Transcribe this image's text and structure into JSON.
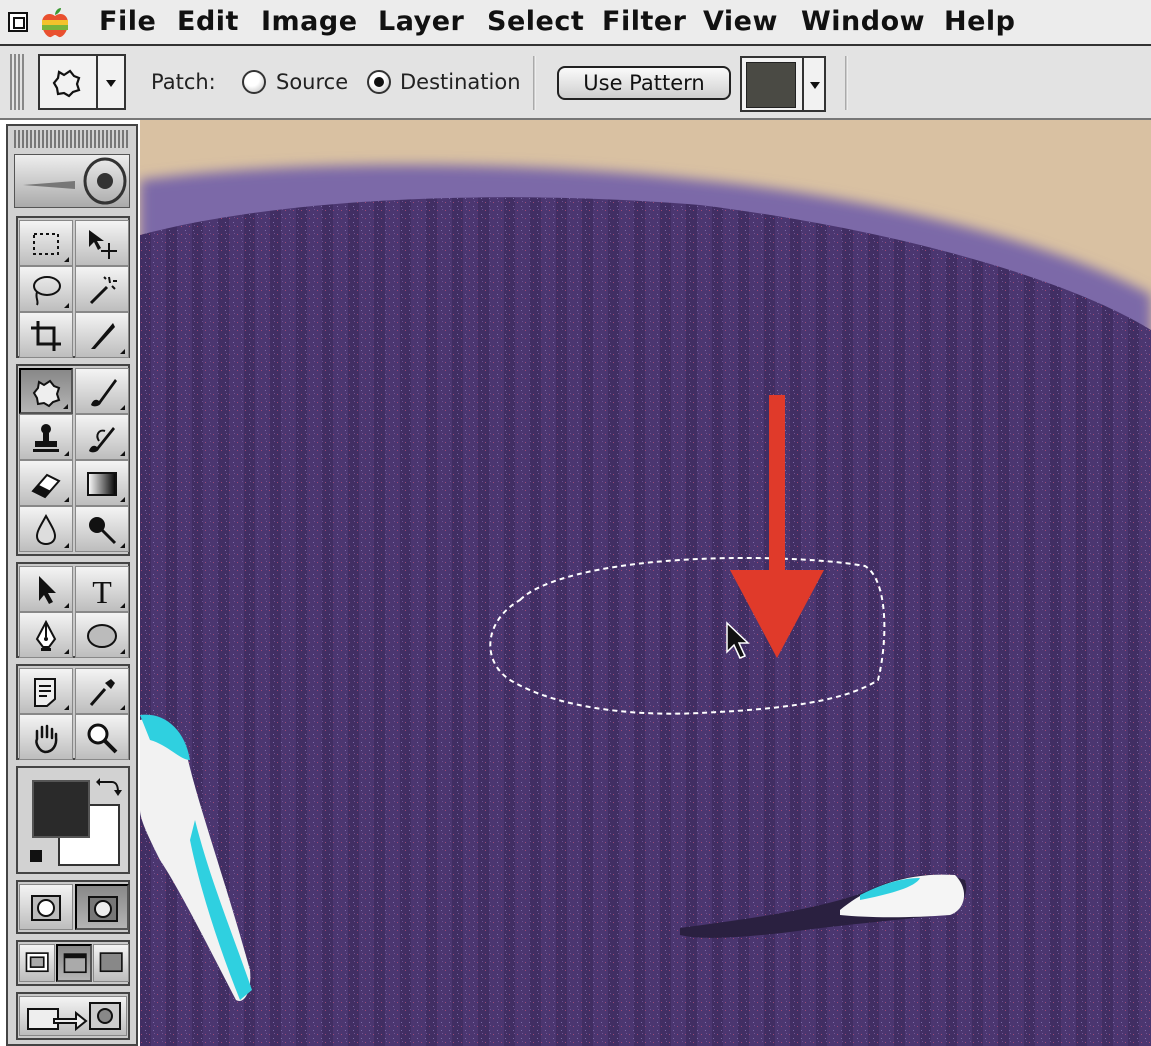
{
  "menu": [
    "File",
    "Edit",
    "Image",
    "Layer",
    "Select",
    "Filter",
    "View",
    "Window",
    "Help"
  ],
  "options": {
    "patch_label": "Patch:",
    "source_label": "Source",
    "destination_label": "Destination",
    "selected": "Destination",
    "use_pattern_label": "Use Pattern",
    "pattern_color": "#4a4a44"
  },
  "toolbox": {
    "foreground_color": "#2a2a2a",
    "background_color": "#ffffff",
    "active_tool": "patch-tool",
    "tools": [
      "marquee",
      "move",
      "lasso",
      "magic-wand",
      "crop",
      "slice",
      "patch",
      "brush",
      "stamp",
      "history-brush",
      "eraser",
      "gradient",
      "blur",
      "dodge",
      "path-select",
      "type",
      "pen",
      "ellipse",
      "notes",
      "eyedropper",
      "hand",
      "zoom"
    ]
  },
  "canvas": {
    "beige_color": "#d7bf9f",
    "purple_color": "#4a356f",
    "arrow_color": "#e03a2a"
  }
}
